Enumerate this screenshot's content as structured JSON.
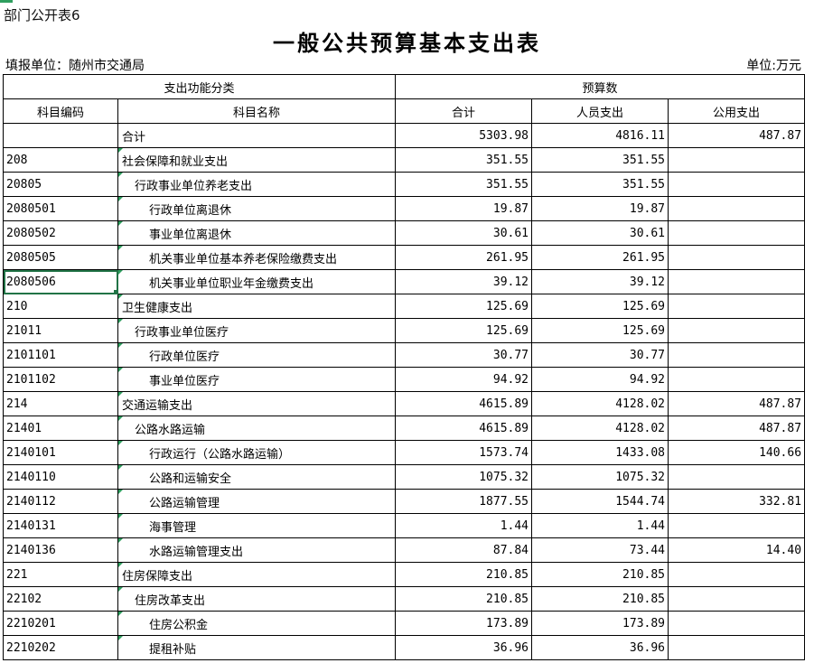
{
  "sheet_label": "部门公开表6",
  "title": "一般公共预算基本支出表",
  "unit_left": "填报单位：随州市交通局",
  "unit_right": "单位:万元",
  "header": {
    "group1": "支出功能分类",
    "group2": "预算数",
    "code": "科目编码",
    "name": "科目名称",
    "total": "合计",
    "personnel": "人员支出",
    "public": "公用支出"
  },
  "colors": {
    "grid": "#000000",
    "marker": "#2e9e5e",
    "selection": "#217346"
  },
  "selected_cell": "2080506",
  "rows": [
    {
      "code": "",
      "name": "合计",
      "level": 1,
      "total": "5303.98",
      "personnel": "4816.11",
      "public": "487.87"
    },
    {
      "code": "208",
      "name": "社会保障和就业支出",
      "level": 1,
      "total": "351.55",
      "personnel": "351.55",
      "public": ""
    },
    {
      "code": "20805",
      "name": "行政事业单位养老支出",
      "level": 2,
      "total": "351.55",
      "personnel": "351.55",
      "public": ""
    },
    {
      "code": "2080501",
      "name": "行政单位离退休",
      "level": 3,
      "total": "19.87",
      "personnel": "19.87",
      "public": ""
    },
    {
      "code": "2080502",
      "name": "事业单位离退休",
      "level": 3,
      "total": "30.61",
      "personnel": "30.61",
      "public": ""
    },
    {
      "code": "2080505",
      "name": "机关事业单位基本养老保险缴费支出",
      "level": 3,
      "total": "261.95",
      "personnel": "261.95",
      "public": ""
    },
    {
      "code": "2080506",
      "name": "机关事业单位职业年金缴费支出",
      "level": 3,
      "total": "39.12",
      "personnel": "39.12",
      "public": ""
    },
    {
      "code": "210",
      "name": "卫生健康支出",
      "level": 1,
      "total": "125.69",
      "personnel": "125.69",
      "public": ""
    },
    {
      "code": "21011",
      "name": "行政事业单位医疗",
      "level": 2,
      "total": "125.69",
      "personnel": "125.69",
      "public": ""
    },
    {
      "code": "2101101",
      "name": "行政单位医疗",
      "level": 3,
      "total": "30.77",
      "personnel": "30.77",
      "public": ""
    },
    {
      "code": "2101102",
      "name": "事业单位医疗",
      "level": 3,
      "total": "94.92",
      "personnel": "94.92",
      "public": ""
    },
    {
      "code": "214",
      "name": "交通运输支出",
      "level": 1,
      "total": "4615.89",
      "personnel": "4128.02",
      "public": "487.87"
    },
    {
      "code": "21401",
      "name": "公路水路运输",
      "level": 2,
      "total": "4615.89",
      "personnel": "4128.02",
      "public": "487.87"
    },
    {
      "code": "2140101",
      "name": "行政运行（公路水路运输）",
      "level": 3,
      "total": "1573.74",
      "personnel": "1433.08",
      "public": "140.66"
    },
    {
      "code": "2140110",
      "name": "公路和运输安全",
      "level": 3,
      "total": "1075.32",
      "personnel": "1075.32",
      "public": ""
    },
    {
      "code": "2140112",
      "name": "公路运输管理",
      "level": 3,
      "total": "1877.55",
      "personnel": "1544.74",
      "public": "332.81"
    },
    {
      "code": "2140131",
      "name": "海事管理",
      "level": 3,
      "total": "1.44",
      "personnel": "1.44",
      "public": ""
    },
    {
      "code": "2140136",
      "name": "水路运输管理支出",
      "level": 3,
      "total": "87.84",
      "personnel": "73.44",
      "public": "14.40"
    },
    {
      "code": "221",
      "name": "住房保障支出",
      "level": 1,
      "total": "210.85",
      "personnel": "210.85",
      "public": ""
    },
    {
      "code": "22102",
      "name": "住房改革支出",
      "level": 2,
      "total": "210.85",
      "personnel": "210.85",
      "public": ""
    },
    {
      "code": "2210201",
      "name": "住房公积金",
      "level": 3,
      "total": "173.89",
      "personnel": "173.89",
      "public": ""
    },
    {
      "code": "2210202",
      "name": "提租补贴",
      "level": 3,
      "total": "36.96",
      "personnel": "36.96",
      "public": ""
    }
  ]
}
